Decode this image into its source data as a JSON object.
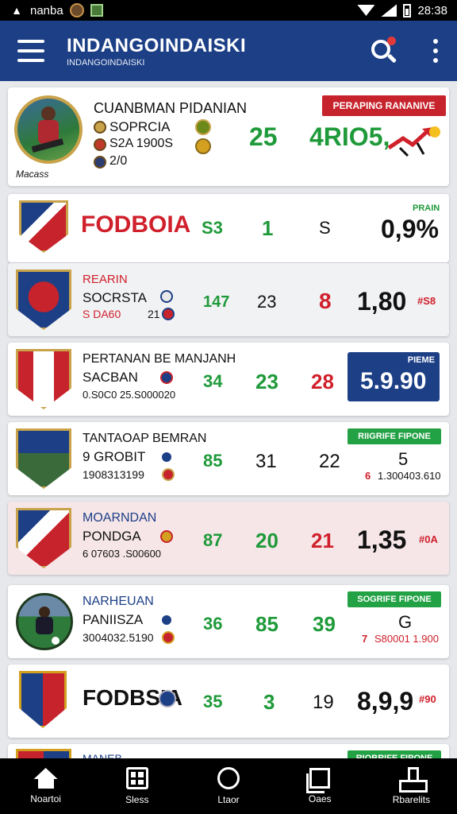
{
  "status_bar": {
    "app_name": "nanba",
    "time": "28:38"
  },
  "app_bar": {
    "title": "INDANGOINDAISKI",
    "subtitle": "INDANGOINDAISKI",
    "search_label": "",
    "more_label": ""
  },
  "colors": {
    "app_bar": "#1c3f86",
    "green": "#1f9a3a",
    "red": "#d0202b",
    "navy": "#1c3f86"
  },
  "featured": {
    "title": "CUANBMAN PIDANIAN",
    "line1": "SOPRCIA",
    "line2": "S2A 1900S",
    "line3": "2/0",
    "caption": "Macass",
    "score": "25",
    "result": "4RIO5,",
    "tag": "PERAPING RANANIVE"
  },
  "rows": [
    {
      "name": "FODBOIA",
      "c1": "S3",
      "c2": "1",
      "c3": "S",
      "value": "0,9%",
      "tag": "PRAIN"
    },
    {
      "name": "REARIN",
      "line1": "SOCRSTA",
      "line2": "S DA60",
      "aux": "21",
      "c1": "147",
      "c2": "23",
      "c3": "8",
      "value": "1,80",
      "extra": "#S8"
    },
    {
      "name": "PERTANAN BE MANJANH",
      "line1": "SACBAN",
      "line2": "0.S0C0 25.S000020",
      "c1": "34",
      "c2": "23",
      "c3": "28",
      "box_label": "PIEME",
      "box_value": "5.9.90"
    },
    {
      "name": "TANTAOAP BEMRAN",
      "line1": "9 GROBIT",
      "line2": "1908313199",
      "c1": "85",
      "c2": "31",
      "c3": "22",
      "tag": "RIIGRIFE FIPONE",
      "value": "5",
      "sub": "1.300403.610",
      "sub_prefix": "6"
    },
    {
      "name": "MOARNDAN",
      "line1": "PONDGA",
      "line2": "6 07603 .S00600",
      "c1": "87",
      "c2": "20",
      "c3": "21",
      "value": "1,35",
      "extra": "#0A"
    },
    {
      "name": "NARHEUAN",
      "line1": "PANIISZA",
      "line2": "3004032.5190",
      "c1": "36",
      "c2": "85",
      "c3": "39",
      "tag": "SOGRIFE FIPONE",
      "value": "G",
      "sub": "S80001 1.900",
      "sub_prefix": "7"
    },
    {
      "name": "FODBSIA",
      "c1": "35",
      "c2": "3",
      "c3": "19",
      "value": "8,9,9",
      "extra": "#90"
    },
    {
      "name": "MANEB",
      "tag": "RIOBRIFE FIPONE"
    }
  ],
  "nav": [
    {
      "label": "Noartoi",
      "icon": "home-icon"
    },
    {
      "label": "Sless",
      "icon": "grid-icon"
    },
    {
      "label": "Ltaor",
      "icon": "circle-icon"
    },
    {
      "label": "Oaes",
      "icon": "square-icon"
    },
    {
      "label": "Rbarelits",
      "icon": "person-icon"
    }
  ]
}
